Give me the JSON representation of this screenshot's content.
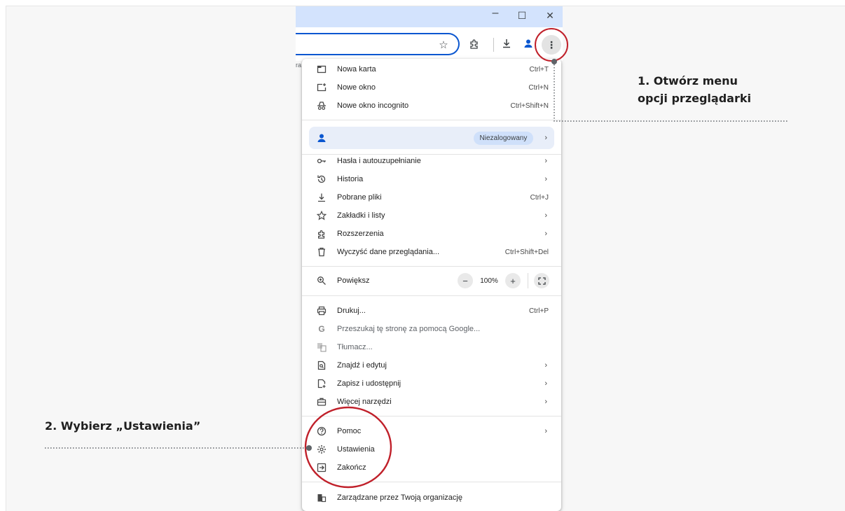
{
  "window": {
    "minimize_icon": "minimize-icon",
    "maximize_icon": "maximize-icon",
    "close_icon": "close-icon",
    "minimize_glyph": "–",
    "maximize_glyph": "☐",
    "close_glyph": "✕"
  },
  "toolbar": {
    "bookmark_hint": "ra",
    "star_glyph": "☆",
    "menu_glyph": "⋮"
  },
  "menu": {
    "top_items": [
      {
        "label": "Nowa karta",
        "shortcut": "Ctrl+T",
        "icon": "new-tab-icon"
      },
      {
        "label": "Nowe okno",
        "shortcut": "Ctrl+N",
        "icon": "new-window-icon"
      },
      {
        "label": "Nowe okno incognito",
        "shortcut": "Ctrl+Shift+N",
        "icon": "incognito-icon"
      }
    ],
    "profile": {
      "status": "Niezalogowany",
      "icon": "profile-icon"
    },
    "mid_items": [
      {
        "label": "Hasła i autouzupełnianie",
        "arrow": "›",
        "icon": "key-icon"
      },
      {
        "label": "Historia",
        "arrow": "›",
        "icon": "history-icon"
      },
      {
        "label": "Pobrane pliki",
        "shortcut": "Ctrl+J",
        "icon": "download-icon"
      },
      {
        "label": "Zakładki i listy",
        "arrow": "›",
        "icon": "star-icon"
      },
      {
        "label": "Rozszerzenia",
        "arrow": "›",
        "icon": "extension-icon"
      },
      {
        "label": "Wyczyść dane przeglądania...",
        "shortcut": "Ctrl+Shift+Del",
        "icon": "trash-icon"
      }
    ],
    "zoom": {
      "label": "Powiększ",
      "value": "100%",
      "minus": "−",
      "plus": "+",
      "icon": "zoom-icon"
    },
    "tool_items": [
      {
        "label": "Drukuj...",
        "shortcut": "Ctrl+P",
        "icon": "print-icon"
      },
      {
        "label": "Przeszukaj tę stronę za pomocą Google...",
        "icon": "google-icon"
      },
      {
        "label": "Tłumacz...",
        "icon": "translate-icon"
      },
      {
        "label": "Znajdź i edytuj",
        "arrow": "›",
        "icon": "find-icon"
      },
      {
        "label": "Zapisz i udostępnij",
        "arrow": "›",
        "icon": "save-share-icon"
      },
      {
        "label": "Więcej narzędzi",
        "arrow": "›",
        "icon": "toolbox-icon"
      }
    ],
    "bottom_items": [
      {
        "label": "Pomoc",
        "arrow": "›",
        "icon": "help-icon"
      },
      {
        "label": "Ustawienia",
        "icon": "settings-icon"
      },
      {
        "label": "Zakończ",
        "icon": "exit-icon"
      }
    ],
    "managed": {
      "label": "Zarządzane przez Twoją organizację",
      "icon": "organization-icon"
    }
  },
  "annotations": {
    "step1_line1": "1. Otwórz menu",
    "step1_line2": "opcji przeglądarki",
    "step2": "2. Wybierz „Ustawienia”",
    "highlight_color": "#c0202a",
    "connector_color": "#5f6368"
  }
}
